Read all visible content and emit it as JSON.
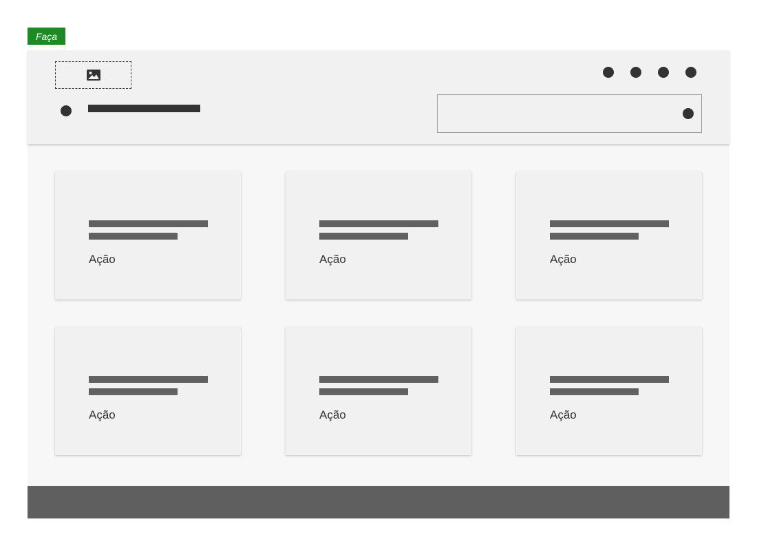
{
  "tag": {
    "label": "Faça",
    "color": "#1e8a23"
  },
  "header": {
    "logo_icon": "image-icon",
    "menu_icons": [
      "dot-icon",
      "dot-icon",
      "dot-icon",
      "dot-icon"
    ]
  },
  "cards": [
    {
      "action_label": "Ação"
    },
    {
      "action_label": "Ação"
    },
    {
      "action_label": "Ação"
    },
    {
      "action_label": "Ação"
    },
    {
      "action_label": "Ação"
    },
    {
      "action_label": "Ação"
    }
  ],
  "colors": {
    "dark": "#333333",
    "placeholder_text": "#616161",
    "header_bg": "#f2f1f1",
    "body_bg": "#f7f7f7",
    "footer_bg": "#5f5f5f"
  }
}
